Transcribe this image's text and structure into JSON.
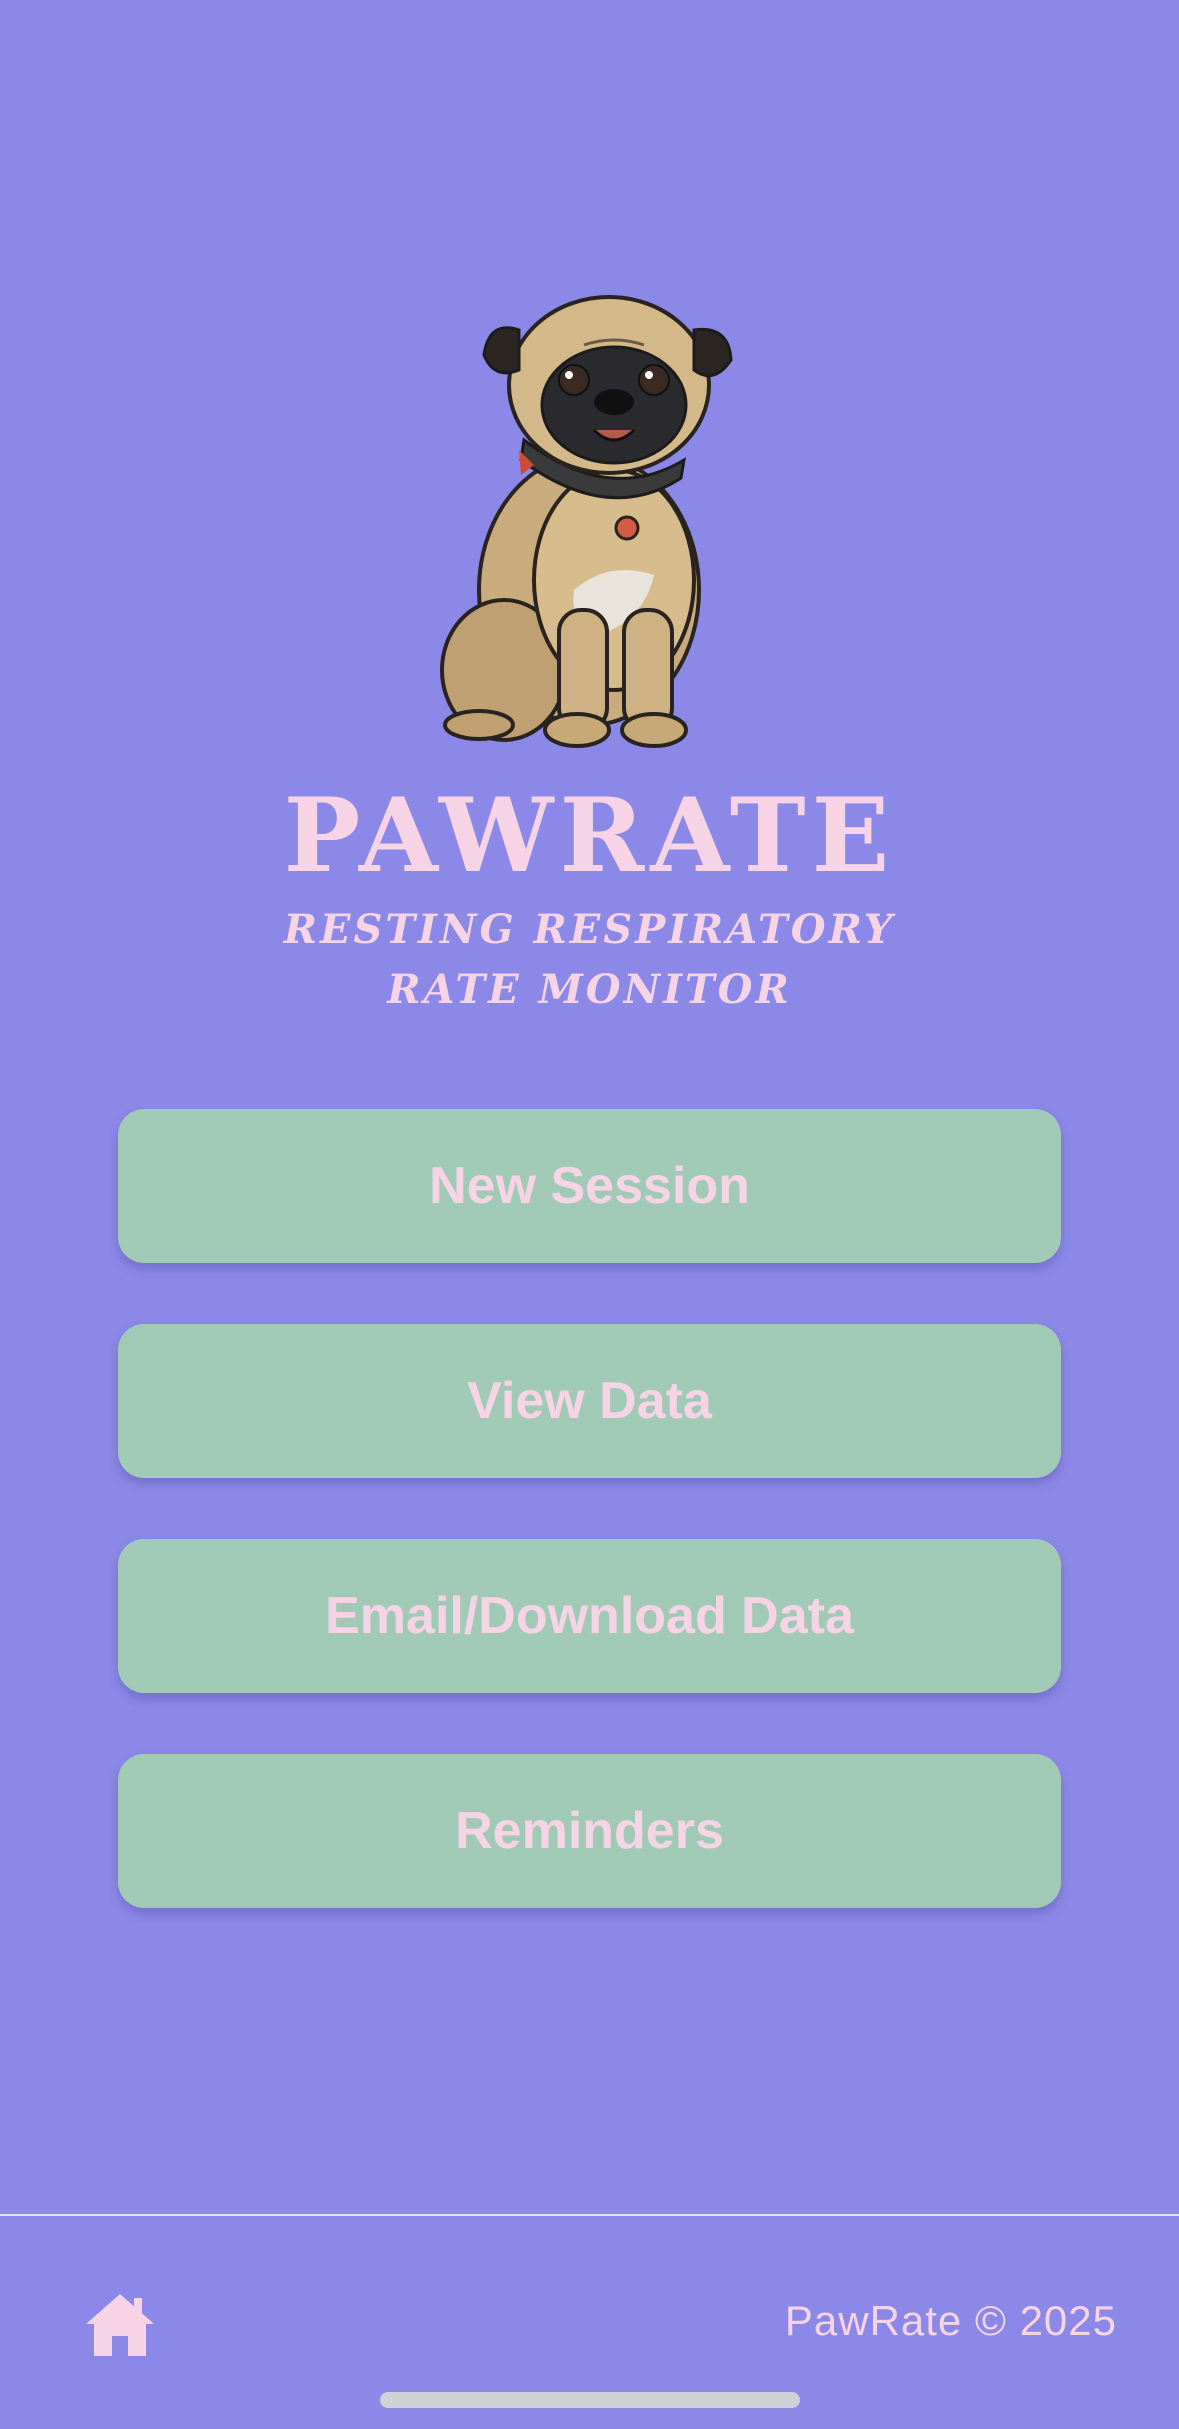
{
  "colors": {
    "background": "#8b88e8",
    "button": "#a1cab6",
    "text_pink": "#f6d3e5",
    "divider": "#e4dcf4"
  },
  "logo": {
    "title": "PAWRATE",
    "subtitle_line1": "RESTING RESPIRATORY",
    "subtitle_line2": "RATE MONITOR",
    "icon": "pug-dog-illustration"
  },
  "menu": {
    "new_session": "New Session",
    "view_data": "View Data",
    "email_download": "Email/Download Data",
    "reminders": "Reminders"
  },
  "footer": {
    "home_icon": "home-icon",
    "copyright": "PawRate © 2025"
  }
}
